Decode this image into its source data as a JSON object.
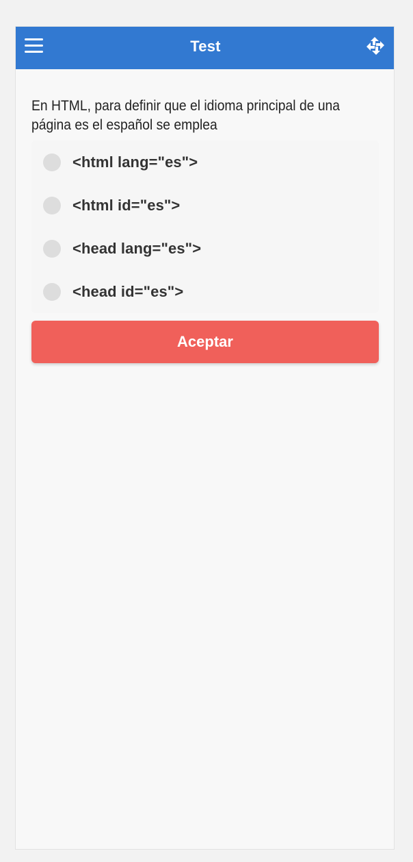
{
  "app": {
    "title": "Test",
    "header_color": "#3279d1",
    "icons": {
      "menu": "hamburger-menu-icon",
      "right": "shuffle-icon"
    }
  },
  "question": {
    "text": "En HTML, para definir que el idioma principal de una página es el español se emplea"
  },
  "options": [
    {
      "label": "<html lang=\"es\">",
      "selected": false
    },
    {
      "label": "<html id=\"es\">",
      "selected": false
    },
    {
      "label": "<head lang=\"es\">",
      "selected": false
    },
    {
      "label": "<head id=\"es\">",
      "selected": false
    }
  ],
  "actions": {
    "accept_label": "Aceptar",
    "accept_color": "#f0605a"
  }
}
